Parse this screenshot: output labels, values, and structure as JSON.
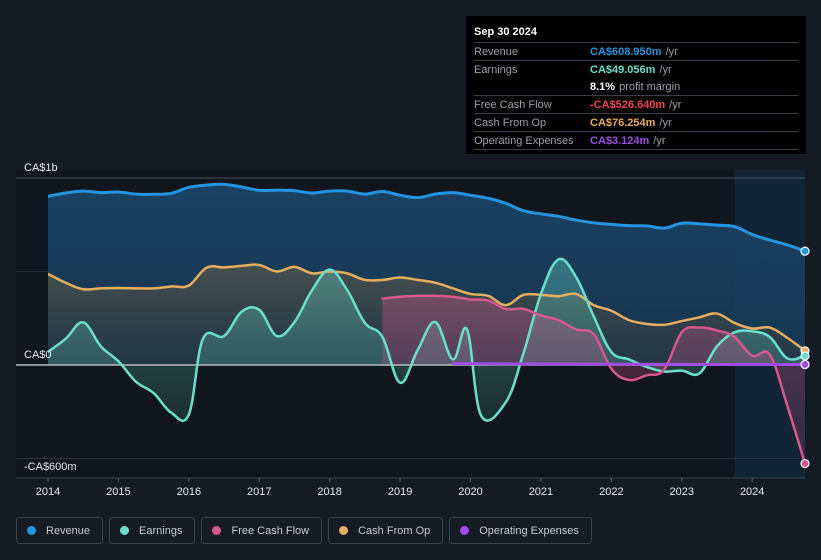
{
  "colors": {
    "revenue": "#2394df",
    "earnings": "#6ae0cc",
    "fcf": "#d8578e",
    "cfo": "#e8ae5f",
    "opex": "#a04de6",
    "background": "#151b24"
  },
  "tooltip": {
    "date": "Sep 30 2024",
    "rows": [
      {
        "label": "Revenue",
        "value": "CA$608.950m",
        "unit": "/yr",
        "color": "#2394df"
      },
      {
        "label": "Earnings",
        "value": "CA$49.056m",
        "unit": "/yr",
        "color": "#6ae0cc"
      },
      {
        "label": "",
        "value": "8.1%",
        "unit": "profit margin",
        "color": "#ffffff"
      },
      {
        "label": "Free Cash Flow",
        "value": "-CA$526.640m",
        "unit": "/yr",
        "color": "#f0464a"
      },
      {
        "label": "Cash From Op",
        "value": "CA$76.254m",
        "unit": "/yr",
        "color": "#e8ae5f"
      },
      {
        "label": "Operating Expenses",
        "value": "CA$3.124m",
        "unit": "/yr",
        "color": "#a04de6"
      }
    ]
  },
  "legend": [
    {
      "label": "Revenue",
      "color": "#2394df"
    },
    {
      "label": "Earnings",
      "color": "#6ae0cc"
    },
    {
      "label": "Free Cash Flow",
      "color": "#d8578e"
    },
    {
      "label": "Cash From Op",
      "color": "#e8ae5f"
    },
    {
      "label": "Operating Expenses",
      "color": "#a04de6"
    }
  ],
  "chart_data": {
    "type": "area",
    "title": "",
    "xlabel": "",
    "ylabel": "",
    "currency": "CA$",
    "unit": "millions",
    "xlim": [
      2014,
      2024.75
    ],
    "ylim": [
      -600,
      1000
    ],
    "y_ticks": [
      {
        "value": 1000,
        "label": "CA$1b"
      },
      {
        "value": 0,
        "label": "CA$0"
      },
      {
        "value": -600,
        "label": "-CA$600m"
      }
    ],
    "x_ticks": [
      "2014",
      "2015",
      "2016",
      "2017",
      "2018",
      "2019",
      "2020",
      "2021",
      "2022",
      "2023",
      "2024"
    ],
    "x_tick_values": [
      2014,
      2015,
      2016,
      2017,
      2018,
      2019,
      2020,
      2021,
      2022,
      2023,
      2024
    ],
    "grid": true,
    "highlight_range": [
      2023.75,
      2024.75
    ],
    "legend_position": "bottom",
    "series": [
      {
        "name": "Revenue",
        "key": "revenue",
        "points": [
          [
            2014.0,
            902
          ],
          [
            2014.25,
            920
          ],
          [
            2014.5,
            930
          ],
          [
            2014.75,
            922
          ],
          [
            2015.0,
            925
          ],
          [
            2015.25,
            914
          ],
          [
            2015.5,
            913
          ],
          [
            2015.75,
            918
          ],
          [
            2016.0,
            950
          ],
          [
            2016.25,
            962
          ],
          [
            2016.5,
            966
          ],
          [
            2016.75,
            952
          ],
          [
            2017.0,
            934
          ],
          [
            2017.25,
            935
          ],
          [
            2017.5,
            932
          ],
          [
            2017.75,
            920
          ],
          [
            2018.0,
            930
          ],
          [
            2018.25,
            930
          ],
          [
            2018.5,
            914
          ],
          [
            2018.75,
            928
          ],
          [
            2019.0,
            908
          ],
          [
            2019.25,
            895
          ],
          [
            2019.5,
            914
          ],
          [
            2019.75,
            922
          ],
          [
            2020.0,
            908
          ],
          [
            2020.25,
            892
          ],
          [
            2020.5,
            865
          ],
          [
            2020.75,
            825
          ],
          [
            2021.0,
            808
          ],
          [
            2021.25,
            795
          ],
          [
            2021.5,
            775
          ],
          [
            2021.75,
            760
          ],
          [
            2022.0,
            752
          ],
          [
            2022.25,
            745
          ],
          [
            2022.5,
            744
          ],
          [
            2022.75,
            732
          ],
          [
            2023.0,
            758
          ],
          [
            2023.25,
            755
          ],
          [
            2023.5,
            748
          ],
          [
            2023.75,
            740
          ],
          [
            2024.0,
            698
          ],
          [
            2024.25,
            668
          ],
          [
            2024.5,
            642
          ],
          [
            2024.75,
            609
          ]
        ]
      },
      {
        "name": "Cash From Op",
        "key": "cfo",
        "points": [
          [
            2014.0,
            487
          ],
          [
            2014.25,
            440
          ],
          [
            2014.5,
            405
          ],
          [
            2014.75,
            410
          ],
          [
            2015.0,
            412
          ],
          [
            2015.25,
            410
          ],
          [
            2015.5,
            410
          ],
          [
            2015.75,
            420
          ],
          [
            2016.0,
            425
          ],
          [
            2016.25,
            520
          ],
          [
            2016.5,
            522
          ],
          [
            2016.75,
            530
          ],
          [
            2017.0,
            535
          ],
          [
            2017.25,
            500
          ],
          [
            2017.5,
            525
          ],
          [
            2017.75,
            490
          ],
          [
            2018.0,
            500
          ],
          [
            2018.25,
            490
          ],
          [
            2018.5,
            455
          ],
          [
            2018.75,
            455
          ],
          [
            2019.0,
            468
          ],
          [
            2019.25,
            455
          ],
          [
            2019.5,
            440
          ],
          [
            2019.75,
            410
          ],
          [
            2020.0,
            380
          ],
          [
            2020.25,
            370
          ],
          [
            2020.5,
            320
          ],
          [
            2020.75,
            375
          ],
          [
            2021.0,
            375
          ],
          [
            2021.25,
            368
          ],
          [
            2021.5,
            380
          ],
          [
            2021.75,
            320
          ],
          [
            2022.0,
            290
          ],
          [
            2022.25,
            240
          ],
          [
            2022.5,
            220
          ],
          [
            2022.75,
            215
          ],
          [
            2023.0,
            235
          ],
          [
            2023.25,
            255
          ],
          [
            2023.5,
            275
          ],
          [
            2023.75,
            225
          ],
          [
            2024.0,
            195
          ],
          [
            2024.25,
            200
          ],
          [
            2024.5,
            145
          ],
          [
            2024.75,
            76
          ]
        ]
      },
      {
        "name": "Earnings",
        "key": "earnings",
        "points": [
          [
            2014.0,
            70
          ],
          [
            2014.25,
            140
          ],
          [
            2014.5,
            228
          ],
          [
            2014.75,
            100
          ],
          [
            2015.0,
            20
          ],
          [
            2015.25,
            -90
          ],
          [
            2015.5,
            -150
          ],
          [
            2015.75,
            -255
          ],
          [
            2016.0,
            -265
          ],
          [
            2016.2,
            140
          ],
          [
            2016.5,
            155
          ],
          [
            2016.75,
            285
          ],
          [
            2017.0,
            295
          ],
          [
            2017.25,
            155
          ],
          [
            2017.5,
            230
          ],
          [
            2017.75,
            400
          ],
          [
            2018.0,
            510
          ],
          [
            2018.25,
            400
          ],
          [
            2018.5,
            225
          ],
          [
            2018.75,
            150
          ],
          [
            2019.0,
            -95
          ],
          [
            2019.25,
            80
          ],
          [
            2019.5,
            230
          ],
          [
            2019.75,
            30
          ],
          [
            2019.95,
            190
          ],
          [
            2020.15,
            -270
          ],
          [
            2020.5,
            -200
          ],
          [
            2020.75,
            60
          ],
          [
            2021.0,
            380
          ],
          [
            2021.25,
            565
          ],
          [
            2021.5,
            470
          ],
          [
            2021.75,
            260
          ],
          [
            2022.0,
            70
          ],
          [
            2022.25,
            30
          ],
          [
            2022.5,
            -10
          ],
          [
            2022.75,
            -35
          ],
          [
            2023.0,
            -30
          ],
          [
            2023.25,
            -45
          ],
          [
            2023.5,
            100
          ],
          [
            2023.75,
            175
          ],
          [
            2024.0,
            180
          ],
          [
            2024.25,
            150
          ],
          [
            2024.5,
            35
          ],
          [
            2024.75,
            49
          ]
        ]
      },
      {
        "name": "Free Cash Flow",
        "key": "fcf",
        "points": [
          [
            2018.75,
            355
          ],
          [
            2019.0,
            365
          ],
          [
            2019.25,
            370
          ],
          [
            2019.5,
            370
          ],
          [
            2019.75,
            365
          ],
          [
            2020.0,
            350
          ],
          [
            2020.25,
            345
          ],
          [
            2020.5,
            300
          ],
          [
            2020.75,
            300
          ],
          [
            2021.0,
            265
          ],
          [
            2021.25,
            240
          ],
          [
            2021.5,
            190
          ],
          [
            2021.75,
            165
          ],
          [
            2022.0,
            -20
          ],
          [
            2022.25,
            -80
          ],
          [
            2022.5,
            -55
          ],
          [
            2022.75,
            -25
          ],
          [
            2023.0,
            175
          ],
          [
            2023.25,
            200
          ],
          [
            2023.5,
            185
          ],
          [
            2023.75,
            150
          ],
          [
            2024.0,
            50
          ],
          [
            2024.25,
            55
          ],
          [
            2024.5,
            -220
          ],
          [
            2024.75,
            -527
          ]
        ]
      },
      {
        "name": "Operating Expenses",
        "key": "opex",
        "points": [
          [
            2019.75,
            8
          ],
          [
            2020.5,
            6
          ],
          [
            2021.5,
            5
          ],
          [
            2022.5,
            4
          ],
          [
            2023.5,
            3
          ],
          [
            2024.75,
            3
          ]
        ]
      }
    ]
  }
}
